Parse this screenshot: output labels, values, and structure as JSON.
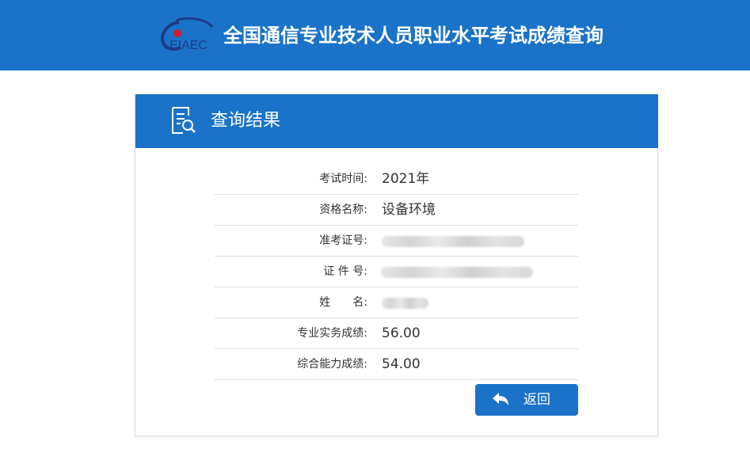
{
  "header": {
    "logo_text": "EIAEC",
    "title": "全国通信专业技术人员职业水平考试成绩查询"
  },
  "panel": {
    "title": "查询结果",
    "rows": [
      {
        "label": "考试时间:",
        "value": "2021年"
      },
      {
        "label": "资格名称:",
        "value": "设备环境"
      },
      {
        "label": "准考证号:",
        "value": ""
      },
      {
        "label": "证 件 号:",
        "value": ""
      },
      {
        "label": "姓　　名:",
        "value": ""
      },
      {
        "label": "专业实务成绩:",
        "value": "56.00"
      },
      {
        "label": "综合能力成绩:",
        "value": "54.00"
      }
    ],
    "back_label": "返回"
  },
  "colors": {
    "primary": "#1a73c8",
    "logo_dark": "#1e3a8a",
    "logo_red": "#d0202a"
  },
  "icons": [
    "eiaec-logo",
    "document-search-icon",
    "back-arrow-icon"
  ]
}
